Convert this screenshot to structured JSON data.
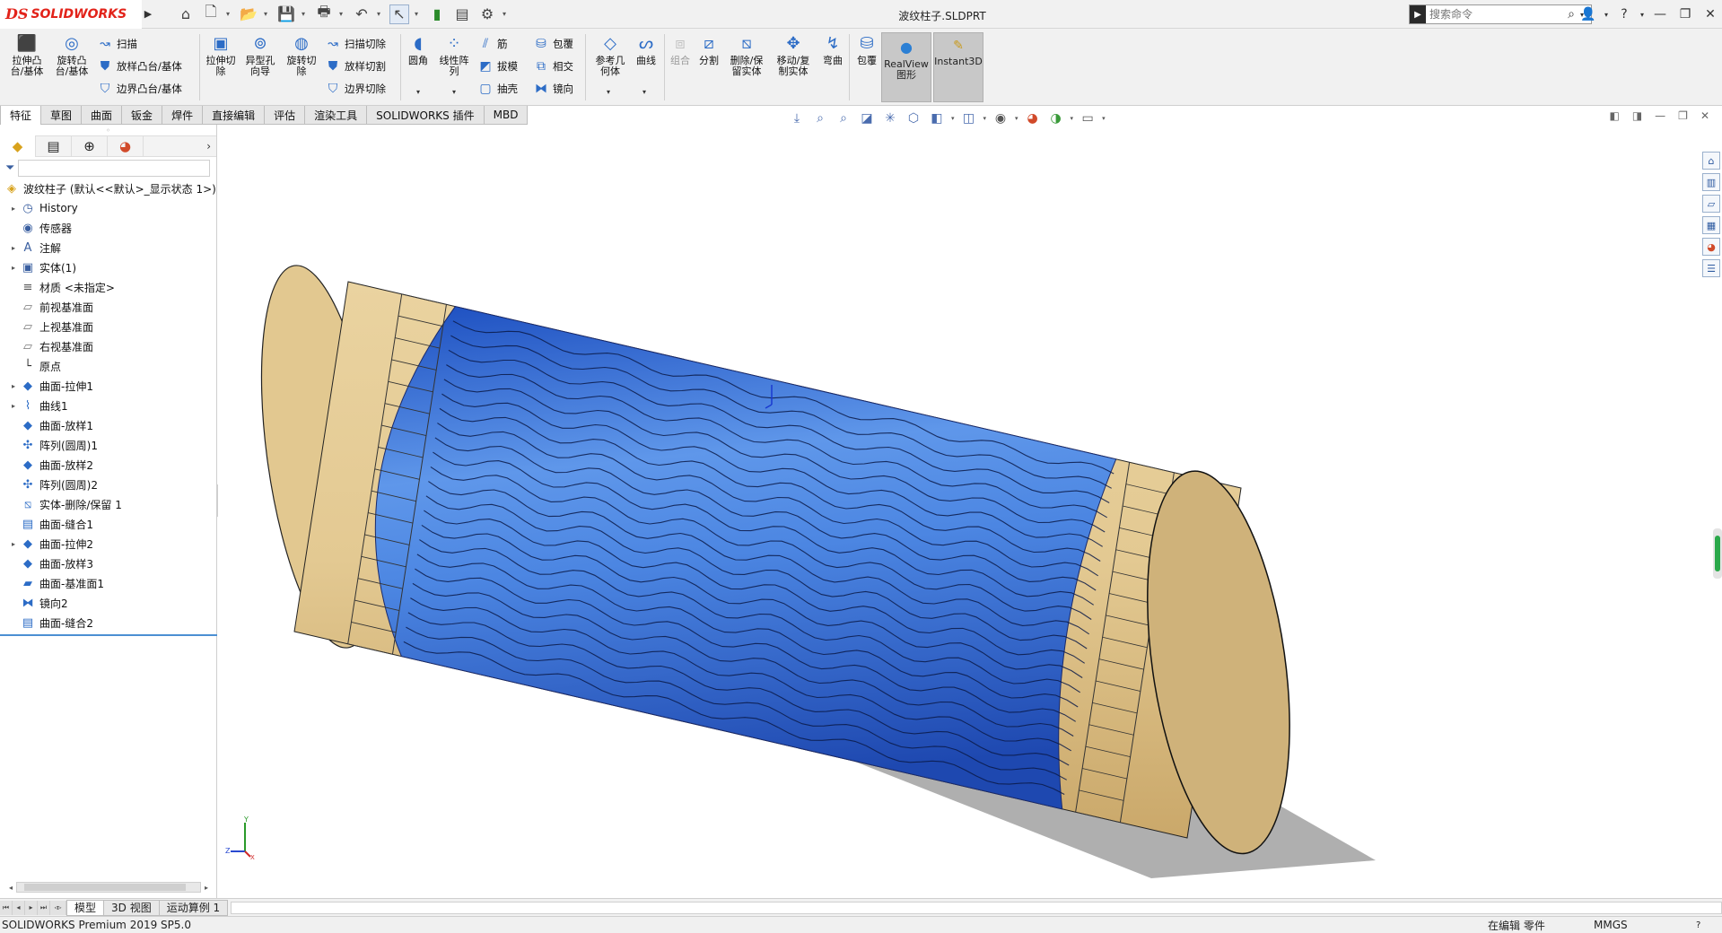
{
  "app": {
    "logo_ds": "DS",
    "logo_name": "SOLIDWORKS",
    "document_title": "波纹柱子.SLDPRT"
  },
  "search": {
    "placeholder": "搜索命令"
  },
  "command_manager": {
    "extrude_boss": "拉伸凸\n台/基体",
    "revolve_boss": "旋转凸\n台/基体",
    "sweep": "扫描",
    "loft_boss": "放样凸台/基体",
    "boundary_boss": "边界凸台/基体",
    "extrude_cut": "拉伸切\n除",
    "hole_wizard": "异型孔\n向导",
    "revolve_cut": "旋转切\n除",
    "sweep_cut": "扫描切除",
    "loft_cut": "放样切割",
    "boundary_cut": "边界切除",
    "fillet": "圆角",
    "linear_pattern": "线性阵\n列",
    "rib": "筋",
    "draft": "拔模",
    "shell": "抽壳",
    "wrap": "包覆",
    "intersect": "相交",
    "mirror": "镜向",
    "ref_geometry": "参考几\n何体",
    "curves": "曲线",
    "combine": "组合",
    "split": "分割",
    "delete_keep_body": "删除/保\n留实体",
    "move_copy_body": "移动/复\n制实体",
    "flex": "弯曲",
    "wrap2": "包覆",
    "realview": "RealView\n图形",
    "instant3d": "Instant3D"
  },
  "tabs": [
    "特征",
    "草图",
    "曲面",
    "钣金",
    "焊件",
    "直接编辑",
    "评估",
    "渲染工具",
    "SOLIDWORKS 插件",
    "MBD"
  ],
  "active_tab": "特征",
  "feature_tree": {
    "root_label": "波纹柱子  (默认<<默认>_显示状态 1>)",
    "nodes": [
      {
        "label": "History",
        "icon": "history-icon",
        "expandable": true
      },
      {
        "label": "传感器",
        "icon": "sensors-icon",
        "expandable": false
      },
      {
        "label": "注解",
        "icon": "annotations-icon",
        "expandable": true
      },
      {
        "label": "实体(1)",
        "icon": "solid-bodies-icon",
        "expandable": true
      },
      {
        "label": "材质 <未指定>",
        "icon": "material-icon",
        "expandable": false
      },
      {
        "label": "前视基准面",
        "icon": "plane-icon",
        "expandable": false
      },
      {
        "label": "上视基准面",
        "icon": "plane-icon",
        "expandable": false
      },
      {
        "label": "右视基准面",
        "icon": "plane-icon",
        "expandable": false
      },
      {
        "label": "原点",
        "icon": "origin-icon",
        "expandable": false
      },
      {
        "label": "曲面-拉伸1",
        "icon": "surface-extrude-icon",
        "expandable": true
      },
      {
        "label": "曲线1",
        "icon": "curve-icon",
        "expandable": true
      },
      {
        "label": "曲面-放样1",
        "icon": "surface-loft-icon",
        "expandable": false
      },
      {
        "label": "阵列(圆周)1",
        "icon": "circular-pattern-icon",
        "expandable": false
      },
      {
        "label": "曲面-放样2",
        "icon": "surface-loft-icon",
        "expandable": false
      },
      {
        "label": "阵列(圆周)2",
        "icon": "circular-pattern-icon",
        "expandable": false
      },
      {
        "label": "实体-删除/保留 1",
        "icon": "delete-body-icon",
        "expandable": false
      },
      {
        "label": "曲面-缝合1",
        "icon": "surface-knit-icon",
        "expandable": false
      },
      {
        "label": "曲面-拉伸2",
        "icon": "surface-extrude-icon",
        "expandable": true
      },
      {
        "label": "曲面-放样3",
        "icon": "surface-loft-icon",
        "expandable": false
      },
      {
        "label": "曲面-基准面1",
        "icon": "planar-surface-icon",
        "expandable": false
      },
      {
        "label": "镜向2",
        "icon": "mirror-icon",
        "expandable": false
      },
      {
        "label": "曲面-缝合2",
        "icon": "surface-knit-icon",
        "expandable": false
      }
    ]
  },
  "bottom_tabs": [
    "模型",
    "3D 视图",
    "运动算例 1"
  ],
  "status_bar": {
    "product": "SOLIDWORKS Premium 2019 SP5.0",
    "mode": "在编辑 零件",
    "units": "MMGS",
    "help": "?"
  },
  "triad": {
    "x": "X",
    "y": "Y",
    "z": "Z"
  },
  "colors": {
    "wave_blue": "#2a6ad8",
    "wave_light": "#6aa0ee",
    "wood": "#d9c08a",
    "end_cap": "#ccb07a",
    "brand_red": "#e2231a"
  }
}
